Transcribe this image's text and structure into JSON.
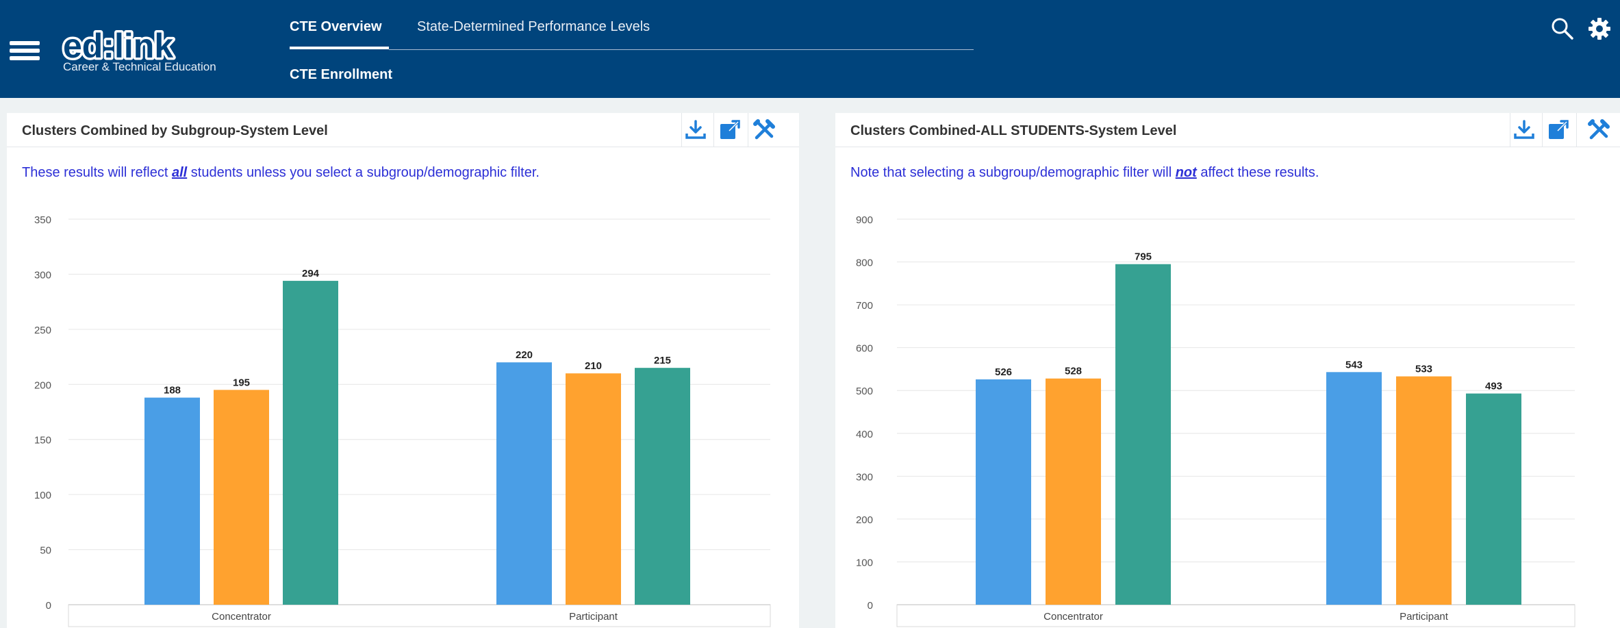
{
  "header": {
    "app_name": "ed:link",
    "app_subtitle": "Career & Technical Education",
    "tabs": [
      {
        "label": "CTE Overview",
        "active": true
      },
      {
        "label": "State-Determined Performance Levels",
        "active": false
      },
      {
        "label": "CTE Enrollment",
        "active": false
      }
    ],
    "icons": [
      "menu-icon",
      "search-icon",
      "settings-gear-icon"
    ],
    "colors": {
      "bar": "#00447c",
      "text": "#ffffff"
    }
  },
  "panels": [
    {
      "title": "Clusters Combined by Subgroup-System Level",
      "note_before": "These results will reflect ",
      "note_em": "all",
      "note_after": " students unless you select a subgroup/demographic filter.",
      "tools": [
        "download-icon",
        "popout-icon",
        "tools-icon"
      ]
    },
    {
      "title": "Clusters Combined-ALL STUDENTS-System Level",
      "note_before": "Note that selecting a subgroup/demographic filter will ",
      "note_em": "not",
      "note_after": " affect these results.",
      "tools": [
        "download-icon",
        "popout-icon",
        "tools-icon"
      ]
    }
  ],
  "chart_data": [
    {
      "type": "bar",
      "categories": [
        "Concentrator",
        "Participant"
      ],
      "series": [
        {
          "values": [
            188,
            220
          ],
          "color": "#4a9ee6"
        },
        {
          "values": [
            195,
            210
          ],
          "color": "#ffa22f"
        },
        {
          "values": [
            294,
            215
          ],
          "color": "#36a192"
        }
      ],
      "yticks": [
        "0",
        "50",
        "100",
        "150",
        "200",
        "250",
        "300",
        "350"
      ],
      "ylim": [
        0,
        350
      ],
      "grid": true
    },
    {
      "type": "bar",
      "categories": [
        "Concentrator",
        "Participant"
      ],
      "series": [
        {
          "values": [
            526,
            543
          ],
          "color": "#4a9ee6"
        },
        {
          "values": [
            528,
            533
          ],
          "color": "#ffa22f"
        },
        {
          "values": [
            795,
            493
          ],
          "color": "#36a192"
        }
      ],
      "yticks": [
        "0",
        "100",
        "200",
        "300",
        "400",
        "500",
        "600",
        "700",
        "800",
        "900"
      ],
      "ylim": [
        0,
        900
      ],
      "grid": true
    }
  ]
}
